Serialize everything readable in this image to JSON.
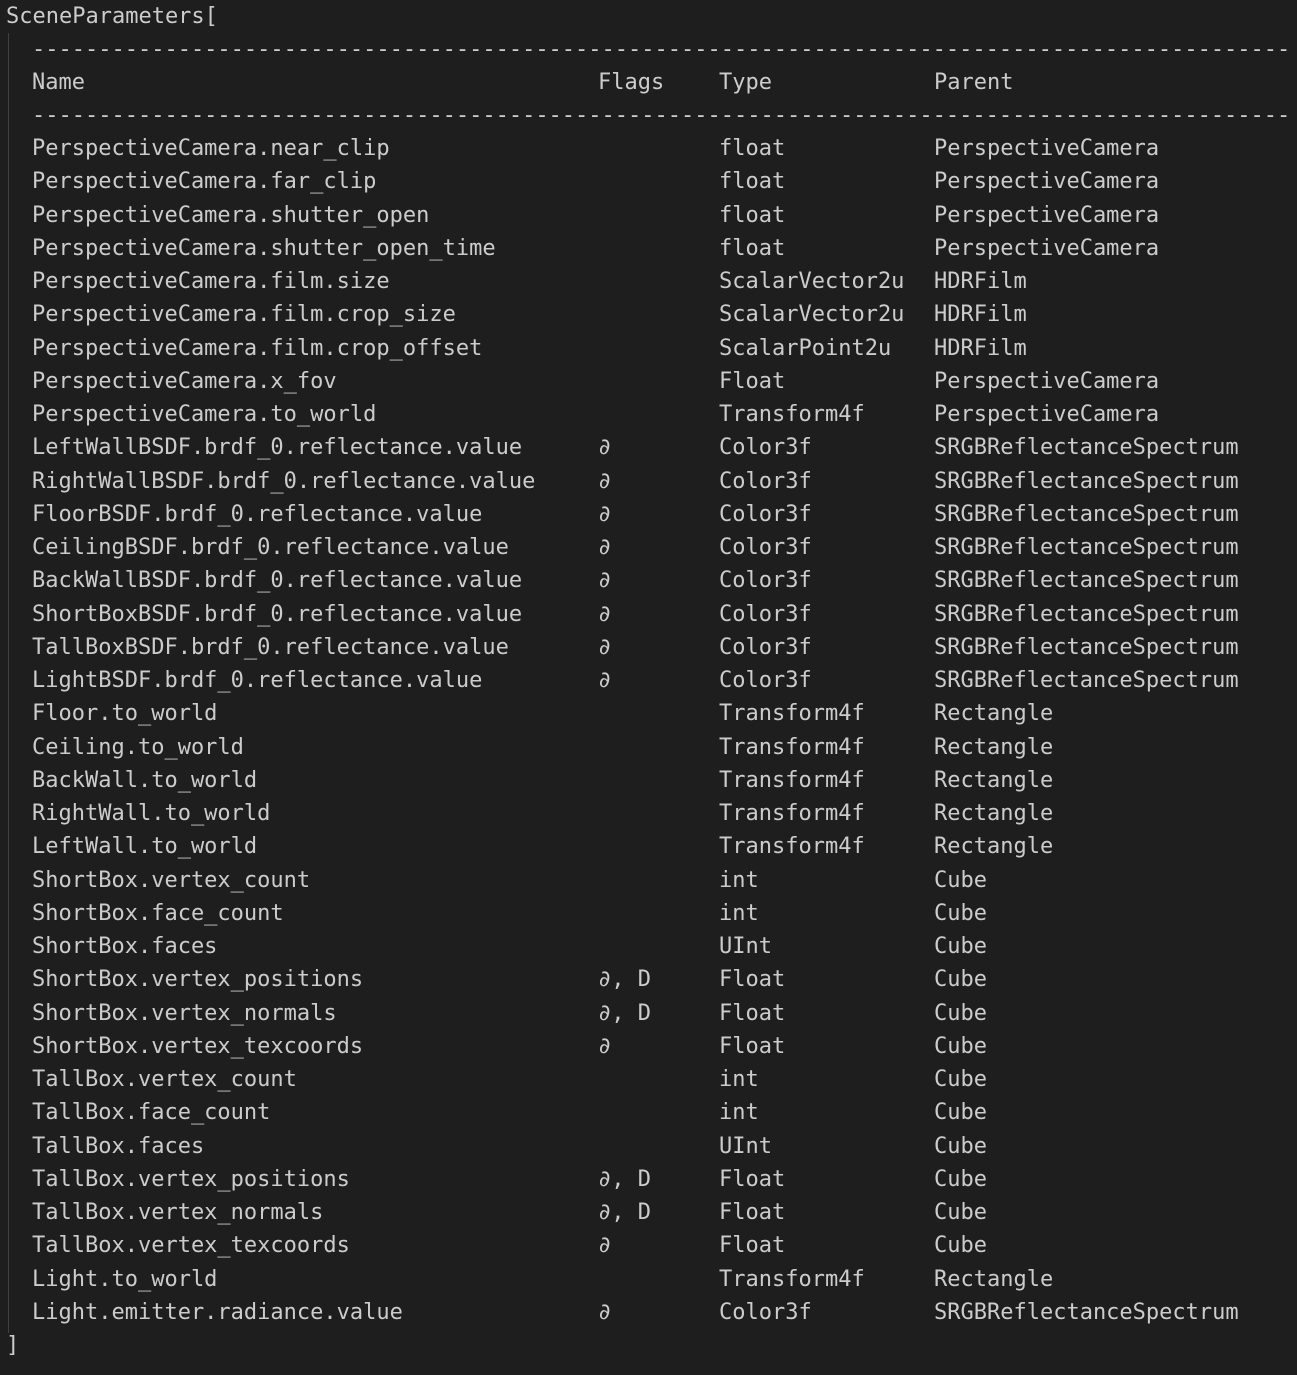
{
  "title": "SceneParameters[",
  "closing": "]",
  "separator": "------------------------------------------------------------------------------------------------------------------------",
  "columns": {
    "name": "Name",
    "flags": "Flags",
    "type": "Type",
    "parent": "Parent"
  },
  "rows": [
    {
      "name": "PerspectiveCamera.near_clip",
      "flags": "",
      "type": "float",
      "parent": "PerspectiveCamera"
    },
    {
      "name": "PerspectiveCamera.far_clip",
      "flags": "",
      "type": "float",
      "parent": "PerspectiveCamera"
    },
    {
      "name": "PerspectiveCamera.shutter_open",
      "flags": "",
      "type": "float",
      "parent": "PerspectiveCamera"
    },
    {
      "name": "PerspectiveCamera.shutter_open_time",
      "flags": "",
      "type": "float",
      "parent": "PerspectiveCamera"
    },
    {
      "name": "PerspectiveCamera.film.size",
      "flags": "",
      "type": "ScalarVector2u",
      "parent": "HDRFilm"
    },
    {
      "name": "PerspectiveCamera.film.crop_size",
      "flags": "",
      "type": "ScalarVector2u",
      "parent": "HDRFilm"
    },
    {
      "name": "PerspectiveCamera.film.crop_offset",
      "flags": "",
      "type": "ScalarPoint2u",
      "parent": "HDRFilm"
    },
    {
      "name": "PerspectiveCamera.x_fov",
      "flags": "",
      "type": "Float",
      "parent": "PerspectiveCamera"
    },
    {
      "name": "PerspectiveCamera.to_world",
      "flags": "",
      "type": "Transform4f",
      "parent": "PerspectiveCamera"
    },
    {
      "name": "LeftWallBSDF.brdf_0.reflectance.value",
      "flags": "∂",
      "type": "Color3f",
      "parent": "SRGBReflectanceSpectrum"
    },
    {
      "name": "RightWallBSDF.brdf_0.reflectance.value",
      "flags": "∂",
      "type": "Color3f",
      "parent": "SRGBReflectanceSpectrum"
    },
    {
      "name": "FloorBSDF.brdf_0.reflectance.value",
      "flags": "∂",
      "type": "Color3f",
      "parent": "SRGBReflectanceSpectrum"
    },
    {
      "name": "CeilingBSDF.brdf_0.reflectance.value",
      "flags": "∂",
      "type": "Color3f",
      "parent": "SRGBReflectanceSpectrum"
    },
    {
      "name": "BackWallBSDF.brdf_0.reflectance.value",
      "flags": "∂",
      "type": "Color3f",
      "parent": "SRGBReflectanceSpectrum"
    },
    {
      "name": "ShortBoxBSDF.brdf_0.reflectance.value",
      "flags": "∂",
      "type": "Color3f",
      "parent": "SRGBReflectanceSpectrum"
    },
    {
      "name": "TallBoxBSDF.brdf_0.reflectance.value",
      "flags": "∂",
      "type": "Color3f",
      "parent": "SRGBReflectanceSpectrum"
    },
    {
      "name": "LightBSDF.brdf_0.reflectance.value",
      "flags": "∂",
      "type": "Color3f",
      "parent": "SRGBReflectanceSpectrum"
    },
    {
      "name": "Floor.to_world",
      "flags": "",
      "type": "Transform4f",
      "parent": "Rectangle"
    },
    {
      "name": "Ceiling.to_world",
      "flags": "",
      "type": "Transform4f",
      "parent": "Rectangle"
    },
    {
      "name": "BackWall.to_world",
      "flags": "",
      "type": "Transform4f",
      "parent": "Rectangle"
    },
    {
      "name": "RightWall.to_world",
      "flags": "",
      "type": "Transform4f",
      "parent": "Rectangle"
    },
    {
      "name": "LeftWall.to_world",
      "flags": "",
      "type": "Transform4f",
      "parent": "Rectangle"
    },
    {
      "name": "ShortBox.vertex_count",
      "flags": "",
      "type": "int",
      "parent": "Cube"
    },
    {
      "name": "ShortBox.face_count",
      "flags": "",
      "type": "int",
      "parent": "Cube"
    },
    {
      "name": "ShortBox.faces",
      "flags": "",
      "type": "UInt",
      "parent": "Cube"
    },
    {
      "name": "ShortBox.vertex_positions",
      "flags": "∂, D",
      "type": "Float",
      "parent": "Cube"
    },
    {
      "name": "ShortBox.vertex_normals",
      "flags": "∂, D",
      "type": "Float",
      "parent": "Cube"
    },
    {
      "name": "ShortBox.vertex_texcoords",
      "flags": "∂",
      "type": "Float",
      "parent": "Cube"
    },
    {
      "name": "TallBox.vertex_count",
      "flags": "",
      "type": "int",
      "parent": "Cube"
    },
    {
      "name": "TallBox.face_count",
      "flags": "",
      "type": "int",
      "parent": "Cube"
    },
    {
      "name": "TallBox.faces",
      "flags": "",
      "type": "UInt",
      "parent": "Cube"
    },
    {
      "name": "TallBox.vertex_positions",
      "flags": "∂, D",
      "type": "Float",
      "parent": "Cube"
    },
    {
      "name": "TallBox.vertex_normals",
      "flags": "∂, D",
      "type": "Float",
      "parent": "Cube"
    },
    {
      "name": "TallBox.vertex_texcoords",
      "flags": "∂",
      "type": "Float",
      "parent": "Cube"
    },
    {
      "name": "Light.to_world",
      "flags": "",
      "type": "Transform4f",
      "parent": "Rectangle"
    },
    {
      "name": "Light.emitter.radiance.value",
      "flags": "∂",
      "type": "Color3f",
      "parent": "SRGBReflectanceSpectrum"
    }
  ]
}
